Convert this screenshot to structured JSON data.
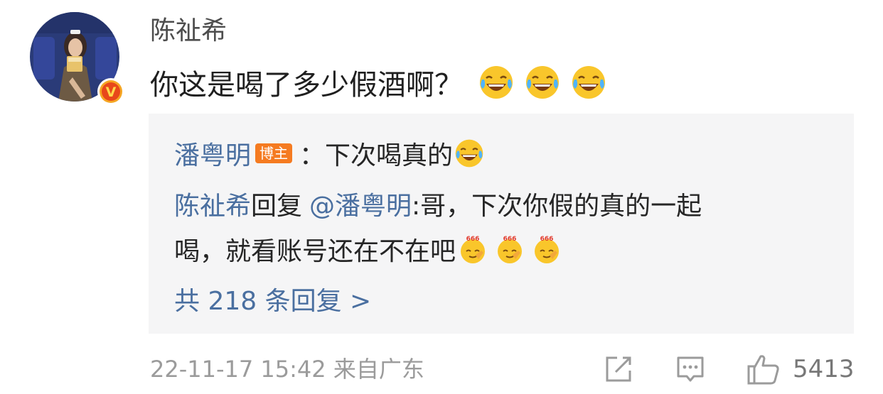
{
  "comment": {
    "author": "陈祉希",
    "text": "你这是喝了多少假酒啊？",
    "emojis": [
      "laugh-cry-emoji",
      "laugh-cry-emoji",
      "laugh-cry-emoji"
    ],
    "avatar_badge": "V"
  },
  "replies": {
    "first": {
      "user": "潘粤明",
      "badge": "博主",
      "separator": "：",
      "text": "下次喝真的"
    },
    "second": {
      "user": "陈祉希",
      "verb": "回复",
      "mention": "@潘粤明",
      "text_line1": ":哥，下次你假的真的一起",
      "text_line2": "喝，就看账号还在不在吧",
      "emoji_label": "666"
    },
    "more": "共 218 条回复 >"
  },
  "footer": {
    "timestamp": "22-11-17 15:42  来自广东",
    "like_count": "5413"
  },
  "colors": {
    "link": "#4a6fa0",
    "badge": "#f57b21",
    "reply_bg": "#f5f5f6",
    "meta": "#9b9b9b"
  }
}
